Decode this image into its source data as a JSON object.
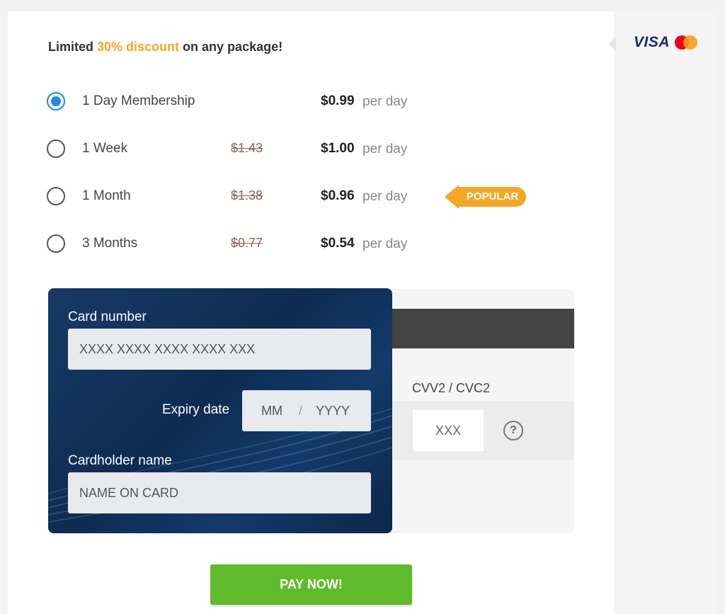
{
  "promo": {
    "prefix": "Limited ",
    "highlight": "30% discount",
    "suffix": " on any package!"
  },
  "payment_brands": {
    "visa": "VISA",
    "mastercard": "mastercard-icon"
  },
  "packages": [
    {
      "name": "1 Day Membership",
      "old_price": "",
      "price": "$0.99",
      "unit": "per day",
      "selected": true
    },
    {
      "name": "1 Week",
      "old_price": "$1.43",
      "price": "$1.00",
      "unit": "per day",
      "selected": false
    },
    {
      "name": "1 Month",
      "old_price": "$1.38",
      "price": "$0.96",
      "unit": "per day",
      "selected": false
    },
    {
      "name": "3 Months",
      "old_price": "$0.77",
      "price": "$0.54",
      "unit": "per day",
      "selected": false
    }
  ],
  "popular_badge": "POPULAR",
  "card": {
    "number_label": "Card number",
    "number_placeholder": "XXXX XXXX XXXX XXXX XXX",
    "expiry_label": "Expiry date",
    "month_placeholder": "MM",
    "separator": "/",
    "year_placeholder": "YYYY",
    "holder_label": "Cardholder name",
    "holder_placeholder": "NAME ON CARD",
    "cvv_label": "CVV2 / CVC2",
    "cvv_placeholder": "XXX",
    "help_symbol": "?"
  },
  "pay_button": "PAY NOW!",
  "colors": {
    "accent": "#f5a623",
    "selected_radio": "#1e88e5",
    "pay_button": "#5fbb2b",
    "card_bg": "#0e2c52"
  }
}
